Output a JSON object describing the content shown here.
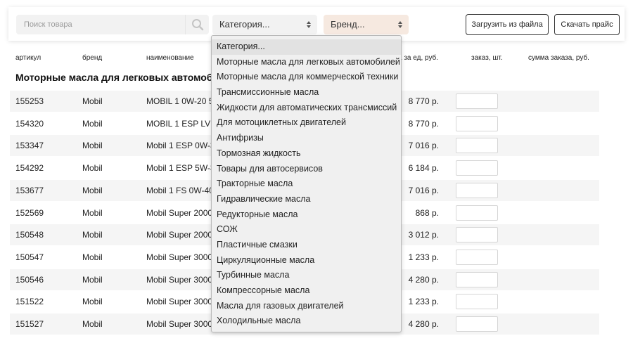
{
  "search": {
    "placeholder": "Поиск товара"
  },
  "filters": {
    "category": "Категория...",
    "brand": "Бренд..."
  },
  "buttons": {
    "upload": "Загрузить из файла",
    "download": "Скачать прайс"
  },
  "table": {
    "headers": {
      "sku": "артикул",
      "brand": "бренд",
      "name": "наименование",
      "price": "а за ед, руб.",
      "qty": "заказ, шт.",
      "sum": "сумма заказа, руб."
    },
    "section_title": "Моторные масла для легковых автомобиле",
    "rows": [
      {
        "sku": "155253",
        "brand": "Mobil",
        "name": "MOBIL 1 0W-20 5L",
        "price": "8 770 р."
      },
      {
        "sku": "154320",
        "brand": "Mobil",
        "name": "MOBIL 1 ESP LV 0",
        "price": "8 770 р."
      },
      {
        "sku": "153347",
        "brand": "Mobil",
        "name": "Mobil 1 ESP 0W-30",
        "price": "7 016 р."
      },
      {
        "sku": "154292",
        "brand": "Mobil",
        "name": "Mobil 1 ESP 5W-30",
        "price": "6 184 р."
      },
      {
        "sku": "153677",
        "brand": "Mobil",
        "name": "Mobil 1 FS 0W-40",
        "price": "7 016 р."
      },
      {
        "sku": "152569",
        "brand": "Mobil",
        "name": "Mobil Super 2000",
        "price": "868 р."
      },
      {
        "sku": "150548",
        "brand": "Mobil",
        "name": "Mobil Super 2000",
        "price": "3 012 р."
      },
      {
        "sku": "150547",
        "brand": "Mobil",
        "name": "Mobil Super 3000",
        "price": "1 233 р."
      },
      {
        "sku": "150546",
        "brand": "Mobil",
        "name": "Mobil Super 3000",
        "price": "4 280 р."
      },
      {
        "sku": "151522",
        "brand": "Mobil",
        "name": "Mobil Super 3000",
        "price": "1 233 р."
      },
      {
        "sku": "151527",
        "brand": "Mobil",
        "name": "Mobil Super 3000",
        "price": "4 280 р."
      }
    ]
  },
  "category_dropdown": {
    "selected_index": 0,
    "options": [
      "Категория...",
      "Моторные масла для легковых автомобилей",
      "Моторные масла для коммерческой техники",
      "Трансмиссионные масла",
      "Жидкости для автоматических трансмиссий",
      "Для мотоциклетных двигателей",
      "Антифризы",
      "Тормозная жидкость",
      "Товары для автосервисов",
      "Тракторные масла",
      "Гидравлические масла",
      "Редукторные масла",
      "СОЖ",
      "Пластичные смазки",
      "Циркуляционные масла",
      "Турбинные масла",
      "Компрессорные масла",
      "Масла для газовых двигателей",
      "Холодильные масла"
    ]
  },
  "icons": {
    "search": "search-icon",
    "select_arrows": "sort-arrows-icon"
  }
}
